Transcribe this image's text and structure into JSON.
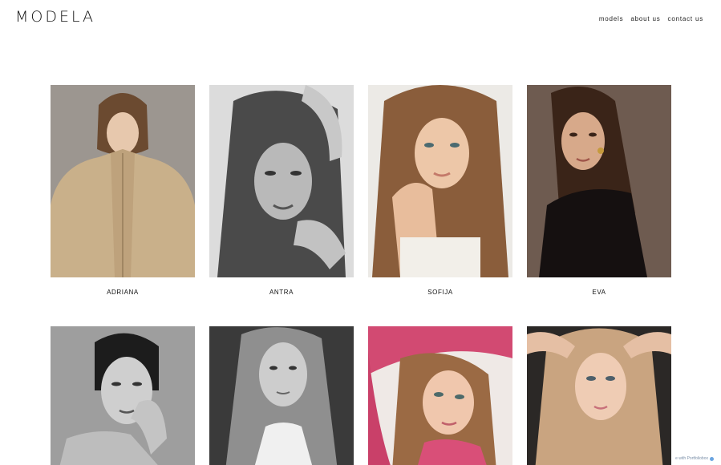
{
  "header": {
    "logo": "MODELA",
    "nav": [
      {
        "label": "models"
      },
      {
        "label": "about us"
      },
      {
        "label": "contact us"
      }
    ]
  },
  "models": [
    {
      "name": "ADRIANA",
      "photo": "portrait-beige-jacket"
    },
    {
      "name": "ANTRA",
      "photo": "portrait-bw-hand-in-hair"
    },
    {
      "name": "SOFIJA",
      "photo": "portrait-long-hair-chin-on-hand"
    },
    {
      "name": "EVA",
      "photo": "portrait-black-top-earrings"
    },
    {
      "name": "",
      "photo": "portrait-bw-hand-on-cheek"
    },
    {
      "name": "",
      "photo": "portrait-bw-lace-collar"
    },
    {
      "name": "",
      "photo": "portrait-pink-knit-hat"
    },
    {
      "name": "",
      "photo": "portrait-hands-on-head"
    }
  ],
  "footer_badge": {
    "text": "e with Portfoliobox"
  }
}
